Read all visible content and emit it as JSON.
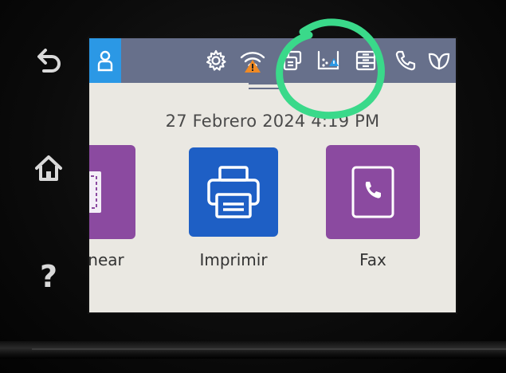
{
  "side_buttons": [
    {
      "id": "back",
      "icon": "back-arrow-icon"
    },
    {
      "id": "home",
      "icon": "home-icon"
    },
    {
      "id": "help",
      "icon": "help-icon",
      "label": "?"
    }
  ],
  "status_bar": {
    "icons": [
      "user-icon",
      "settings-gear-icon",
      "wifi-warning-icon",
      "copy-icon",
      "ink-level-warning-icon",
      "tray-icon",
      "phone-icon",
      "eco-leaf-icon"
    ]
  },
  "home": {
    "datetime": "27 Febrero 2024  4:19 PM",
    "tiles": [
      {
        "label": "near",
        "icon": "scan-icon",
        "color": "#8b4aa0"
      },
      {
        "label": "Imprimir",
        "icon": "printer-icon",
        "color": "#1e5fc5"
      },
      {
        "label": "Fax",
        "icon": "fax-phone-icon",
        "color": "#8b4aa0"
      }
    ]
  },
  "annotation": {
    "color": "#3ad98a",
    "description": "green circle hand drawn around ink icon"
  },
  "colors": {
    "status_bar": "#67708b",
    "user_button": "#2b98e5",
    "screen_bg": "#eae8e2"
  }
}
